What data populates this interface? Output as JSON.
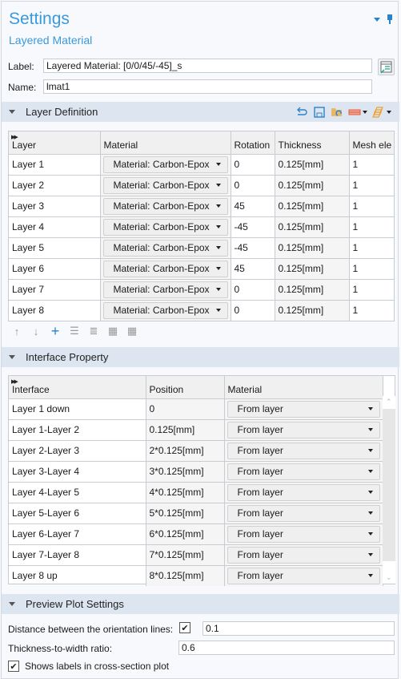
{
  "header": {
    "title": "Settings",
    "subtitle": "Layered Material",
    "menu_icon": "dropdown-triangle-icon",
    "pin_icon": "pin-icon"
  },
  "fields": {
    "label_caption": "Label:",
    "label_value": "Layered Material: [0/0/45/-45]_s",
    "name_caption": "Name:",
    "name_value": "lmat1"
  },
  "layer_definition": {
    "title": "Layer Definition",
    "toolbar_icons": [
      "undo-icon",
      "save-icon",
      "load-from-file-icon",
      "layer-stack-dropdown-icon",
      "layers-dropdown-icon"
    ],
    "columns": [
      "Layer",
      "Material",
      "Rotation",
      "Thickness",
      "Mesh ele"
    ],
    "rows": [
      {
        "layer": "Layer 1",
        "material": "Material: Carbon-Epox",
        "rotation": "0",
        "thickness": "0.125[mm]",
        "mesh": "1"
      },
      {
        "layer": "Layer 2",
        "material": "Material: Carbon-Epox",
        "rotation": "0",
        "thickness": "0.125[mm]",
        "mesh": "1"
      },
      {
        "layer": "Layer 3",
        "material": "Material: Carbon-Epox",
        "rotation": "45",
        "thickness": "0.125[mm]",
        "mesh": "1"
      },
      {
        "layer": "Layer 4",
        "material": "Material: Carbon-Epox",
        "rotation": "-45",
        "thickness": "0.125[mm]",
        "mesh": "1"
      },
      {
        "layer": "Layer 5",
        "material": "Material: Carbon-Epox",
        "rotation": "-45",
        "thickness": "0.125[mm]",
        "mesh": "1"
      },
      {
        "layer": "Layer 6",
        "material": "Material: Carbon-Epox",
        "rotation": "45",
        "thickness": "0.125[mm]",
        "mesh": "1"
      },
      {
        "layer": "Layer 7",
        "material": "Material: Carbon-Epox",
        "rotation": "0",
        "thickness": "0.125[mm]",
        "mesh": "1"
      },
      {
        "layer": "Layer 8",
        "material": "Material: Carbon-Epox",
        "rotation": "0",
        "thickness": "0.125[mm]",
        "mesh": "1"
      }
    ],
    "row_tools": [
      "move-up-icon",
      "move-down-icon",
      "add-icon",
      "delete-icon",
      "insert-icon",
      "table-add-icon",
      "table-icon"
    ]
  },
  "interface_property": {
    "title": "Interface Property",
    "columns": [
      "Interface",
      "Position",
      "Material"
    ],
    "rows": [
      {
        "interface": "Layer 1 down",
        "position": "0",
        "material": "From layer"
      },
      {
        "interface": "Layer 1-Layer 2",
        "position": "0.125[mm]",
        "material": "From layer"
      },
      {
        "interface": "Layer 2-Layer 3",
        "position": "2*0.125[mm]",
        "material": "From layer"
      },
      {
        "interface": "Layer 3-Layer 4",
        "position": "3*0.125[mm]",
        "material": "From layer"
      },
      {
        "interface": "Layer 4-Layer 5",
        "position": "4*0.125[mm]",
        "material": "From layer"
      },
      {
        "interface": "Layer 5-Layer 6",
        "position": "5*0.125[mm]",
        "material": "From layer"
      },
      {
        "interface": "Layer 6-Layer 7",
        "position": "6*0.125[mm]",
        "material": "From layer"
      },
      {
        "interface": "Layer 7-Layer 8",
        "position": "7*0.125[mm]",
        "material": "From layer"
      },
      {
        "interface": "Layer 8 up",
        "position": "8*0.125[mm]",
        "material": "From layer"
      }
    ]
  },
  "preview_plot": {
    "title": "Preview Plot Settings",
    "distance_label": "Distance between the orientation lines:",
    "distance_checked": true,
    "distance_value": "0.1",
    "ratio_label": "Thickness-to-width ratio:",
    "ratio_value": "0.6",
    "labels_checkbox_label": "Shows labels in cross-section plot",
    "labels_checked": true
  },
  "colors": {
    "accent": "#3a9ad9",
    "section_bg": "#dde6f0",
    "panel_bg": "#f7f9fc"
  }
}
